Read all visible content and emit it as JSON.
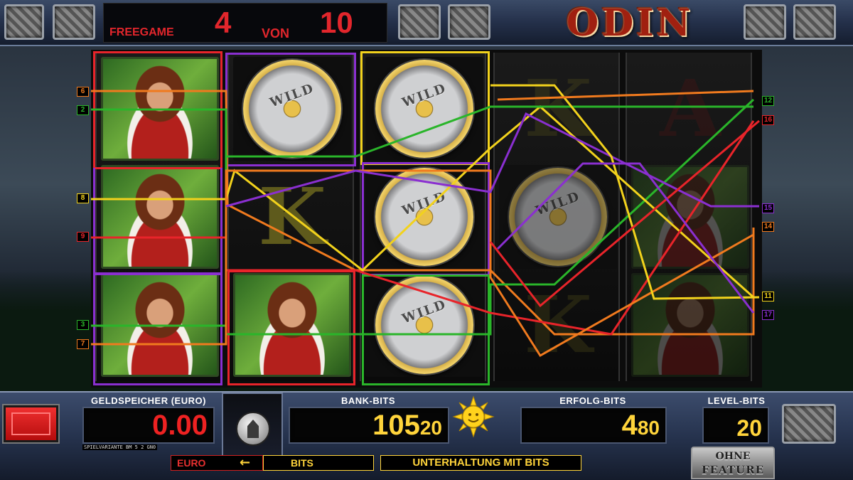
{
  "header": {
    "freegame_label": "FREEGAME",
    "current": "4",
    "von_label": "VON",
    "total": "10",
    "logo": "ODIN"
  },
  "reels": [
    [
      "lady",
      "lady",
      "lady"
    ],
    [
      "wild",
      "K",
      "lady"
    ],
    [
      "wild",
      "wild",
      "wild"
    ],
    [
      "K",
      "wild",
      "K"
    ],
    [
      "A",
      "lady",
      "lady"
    ]
  ],
  "symbols": {
    "wild_text_1": "WILD",
    "wild_text_2": "WILD"
  },
  "left_line_tags": [
    {
      "label": "6",
      "color": "#f07a1e"
    },
    {
      "label": "2",
      "color": "#2ab52a"
    },
    {
      "label": "8",
      "color": "#f2d21c"
    },
    {
      "label": "9",
      "color": "#e8242a"
    },
    {
      "label": "3",
      "color": "#2ab52a"
    },
    {
      "label": "7",
      "color": "#f07a1e"
    }
  ],
  "right_line_tags": [
    {
      "label": "12",
      "color": "#2ab52a"
    },
    {
      "label": "16",
      "color": "#e8242a"
    },
    {
      "label": "15",
      "color": "#8a2fd0"
    },
    {
      "label": "14",
      "color": "#f07a1e"
    },
    {
      "label": "11",
      "color": "#f2d21c"
    },
    {
      "label": "17",
      "color": "#8a2fd0"
    }
  ],
  "panel": {
    "geldspeicher_label": "GELDSPEICHER (EURO)",
    "geldspeicher_value": "0.00",
    "spielvariante": "SPIELVARIANTE BM 5 2 GN0",
    "bank_label": "BANK-BITS",
    "bank_big": "105",
    "bank_small": "20",
    "erfolg_label": "ERFOLG-BITS",
    "erfolg_big": "4",
    "erfolg_small": "80",
    "level_label": "LEVEL-BITS",
    "level_value": "20",
    "conv_euro": "EURO",
    "conv_arrow": "←",
    "conv_bits": "BITS",
    "slogan": "UNTERHALTUNG MIT BITS",
    "ohne_1": "OHNE",
    "ohne_2": "FEATURE"
  },
  "colors": {
    "red": "#e8242a",
    "yellow": "#f2d21c",
    "green": "#2ab52a",
    "orange": "#f07a1e",
    "purple": "#8a2fd0",
    "display_yellow": "#ffd43b",
    "display_red": "#ee2222"
  }
}
